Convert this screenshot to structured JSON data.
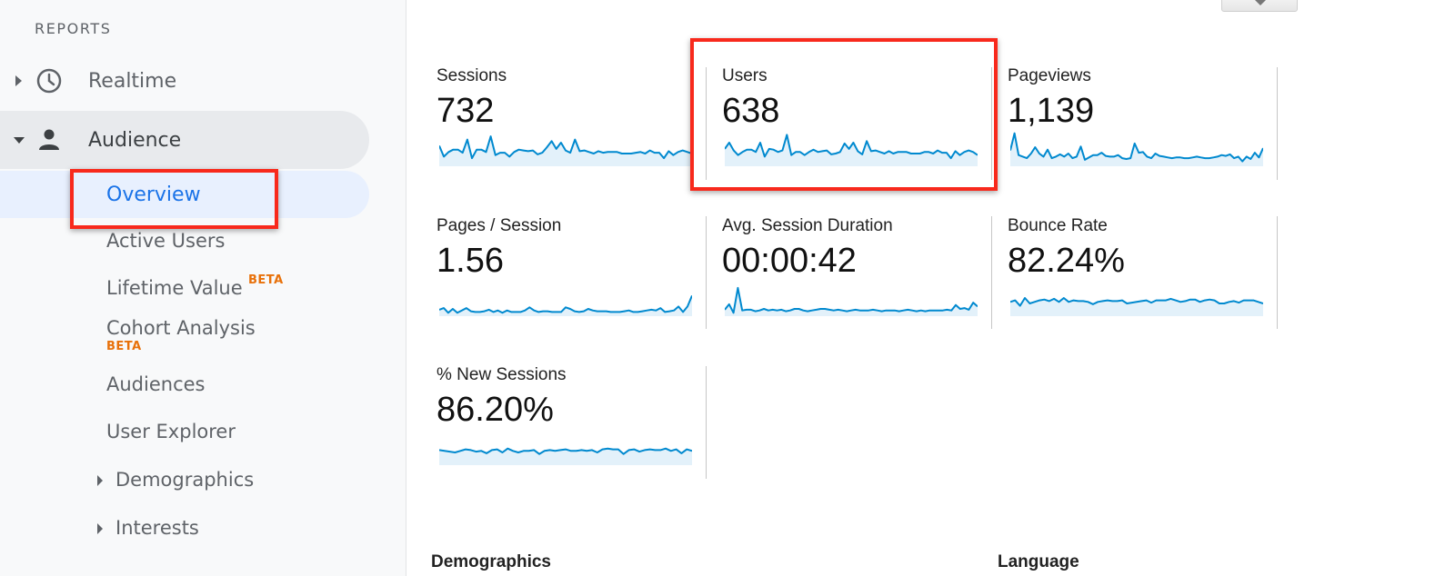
{
  "sidebar": {
    "section_label": "REPORTS",
    "realtime": {
      "label": "Realtime",
      "icon": "clock-icon"
    },
    "audience": {
      "label": "Audience",
      "icon": "person-icon"
    },
    "items": [
      {
        "label": "Overview",
        "active": true
      },
      {
        "label": "Active Users"
      },
      {
        "label": "Lifetime Value",
        "badge": "BETA"
      },
      {
        "label": "Cohort Analysis",
        "badge": "BETA"
      },
      {
        "label": "Audiences"
      },
      {
        "label": "User Explorer"
      },
      {
        "label": "Demographics",
        "expandable": true
      },
      {
        "label": "Interests",
        "expandable": true
      }
    ]
  },
  "metrics": [
    {
      "label": "Sessions",
      "value": "732",
      "trend": [
        52,
        38,
        44,
        47,
        47,
        43,
        60,
        36,
        47,
        47,
        44,
        64,
        40,
        43,
        43,
        38,
        44,
        47,
        46,
        45,
        46,
        41,
        43,
        50,
        58,
        48,
        56,
        46,
        43,
        60,
        45,
        46,
        44,
        42,
        45,
        43,
        44,
        44,
        44,
        42,
        42,
        42,
        43,
        44,
        42,
        46,
        43,
        43,
        36,
        45,
        40,
        44,
        46,
        44,
        42
      ]
    },
    {
      "label": "Users",
      "value": "638",
      "trend": [
        48,
        56,
        46,
        40,
        44,
        47,
        47,
        44,
        56,
        38,
        48,
        47,
        44,
        46,
        66,
        40,
        44,
        44,
        40,
        44,
        47,
        44,
        45,
        46,
        41,
        42,
        44,
        55,
        48,
        56,
        45,
        41,
        58,
        45,
        46,
        44,
        42,
        45,
        42,
        44,
        44,
        44,
        42,
        42,
        42,
        44,
        44,
        42,
        46,
        43,
        43,
        36,
        45,
        40,
        44,
        46,
        44,
        40
      ]
    },
    {
      "label": "Pageviews",
      "value": "1,139",
      "trend": [
        46,
        68,
        40,
        38,
        36,
        42,
        50,
        42,
        38,
        47,
        36,
        38,
        41,
        38,
        42,
        36,
        38,
        51,
        34,
        37,
        40,
        40,
        43,
        39,
        38,
        38,
        40,
        36,
        35,
        36,
        55,
        43,
        44,
        38,
        36,
        42,
        39,
        38,
        37,
        36,
        37,
        37,
        36,
        36,
        37,
        38,
        37,
        36,
        36,
        37,
        38,
        40,
        39,
        41,
        36,
        38,
        32,
        38,
        35,
        43,
        37,
        49
      ]
    },
    {
      "label": "Pages / Session",
      "value": "1.56",
      "trend": [
        34,
        36,
        30,
        35,
        30,
        33,
        36,
        32,
        31,
        31,
        32,
        34,
        31,
        33,
        30,
        33,
        31,
        31,
        31,
        33,
        37,
        33,
        31,
        32,
        32,
        31,
        31,
        31,
        37,
        35,
        32,
        31,
        32,
        35,
        33,
        32,
        32,
        32,
        31,
        31,
        31,
        32,
        33,
        31,
        31,
        32,
        33,
        34,
        33,
        36,
        31,
        32,
        33,
        38,
        31,
        38,
        52
      ]
    },
    {
      "label": "Avg. Session Duration",
      "value": "00:00:42",
      "trend": [
        34,
        41,
        30,
        62,
        33,
        34,
        34,
        32,
        33,
        35,
        33,
        34,
        33,
        34,
        32,
        33,
        35,
        35,
        33,
        32,
        33,
        34,
        35,
        35,
        34,
        33,
        34,
        33,
        32,
        33,
        34,
        33,
        33,
        33,
        34,
        33,
        32,
        33,
        33,
        33,
        32,
        33,
        34,
        33,
        32,
        33,
        32,
        33,
        33,
        33,
        33,
        34,
        33,
        40,
        35,
        36,
        34,
        43,
        38
      ]
    },
    {
      "label": "Bounce Rate",
      "value": "82.24%",
      "trend": [
        44,
        46,
        39,
        49,
        42,
        44,
        46,
        47,
        45,
        48,
        44,
        49,
        44,
        46,
        45,
        45,
        44,
        41,
        44,
        45,
        46,
        45,
        45,
        46,
        42,
        43,
        44,
        45,
        46,
        43,
        46,
        46,
        46,
        48,
        46,
        44,
        45,
        47,
        47,
        44,
        46,
        47,
        46,
        42,
        42,
        44,
        45,
        43,
        46,
        46,
        46,
        44,
        42
      ]
    },
    {
      "label": "% New Sessions",
      "value": "86.20%",
      "trend": [
        45,
        44,
        43,
        42,
        44,
        46,
        45,
        43,
        44,
        41,
        45,
        46,
        42,
        47,
        44,
        42,
        44,
        44,
        45,
        40,
        44,
        45,
        44,
        45,
        46,
        44,
        44,
        45,
        44,
        45,
        42,
        46,
        47,
        46,
        46,
        40,
        45,
        46,
        43,
        45,
        46,
        45,
        45,
        47,
        44,
        46,
        41,
        46,
        44
      ]
    }
  ],
  "bottom_sections": {
    "left": "Demographics",
    "right": "Language"
  },
  "colors": {
    "accent_blue": "#1a73e8",
    "sparkline": "#0089cf",
    "sparkfill": "#e3f1fa",
    "beta": "#e8710a",
    "highlight": "#f8291c"
  }
}
